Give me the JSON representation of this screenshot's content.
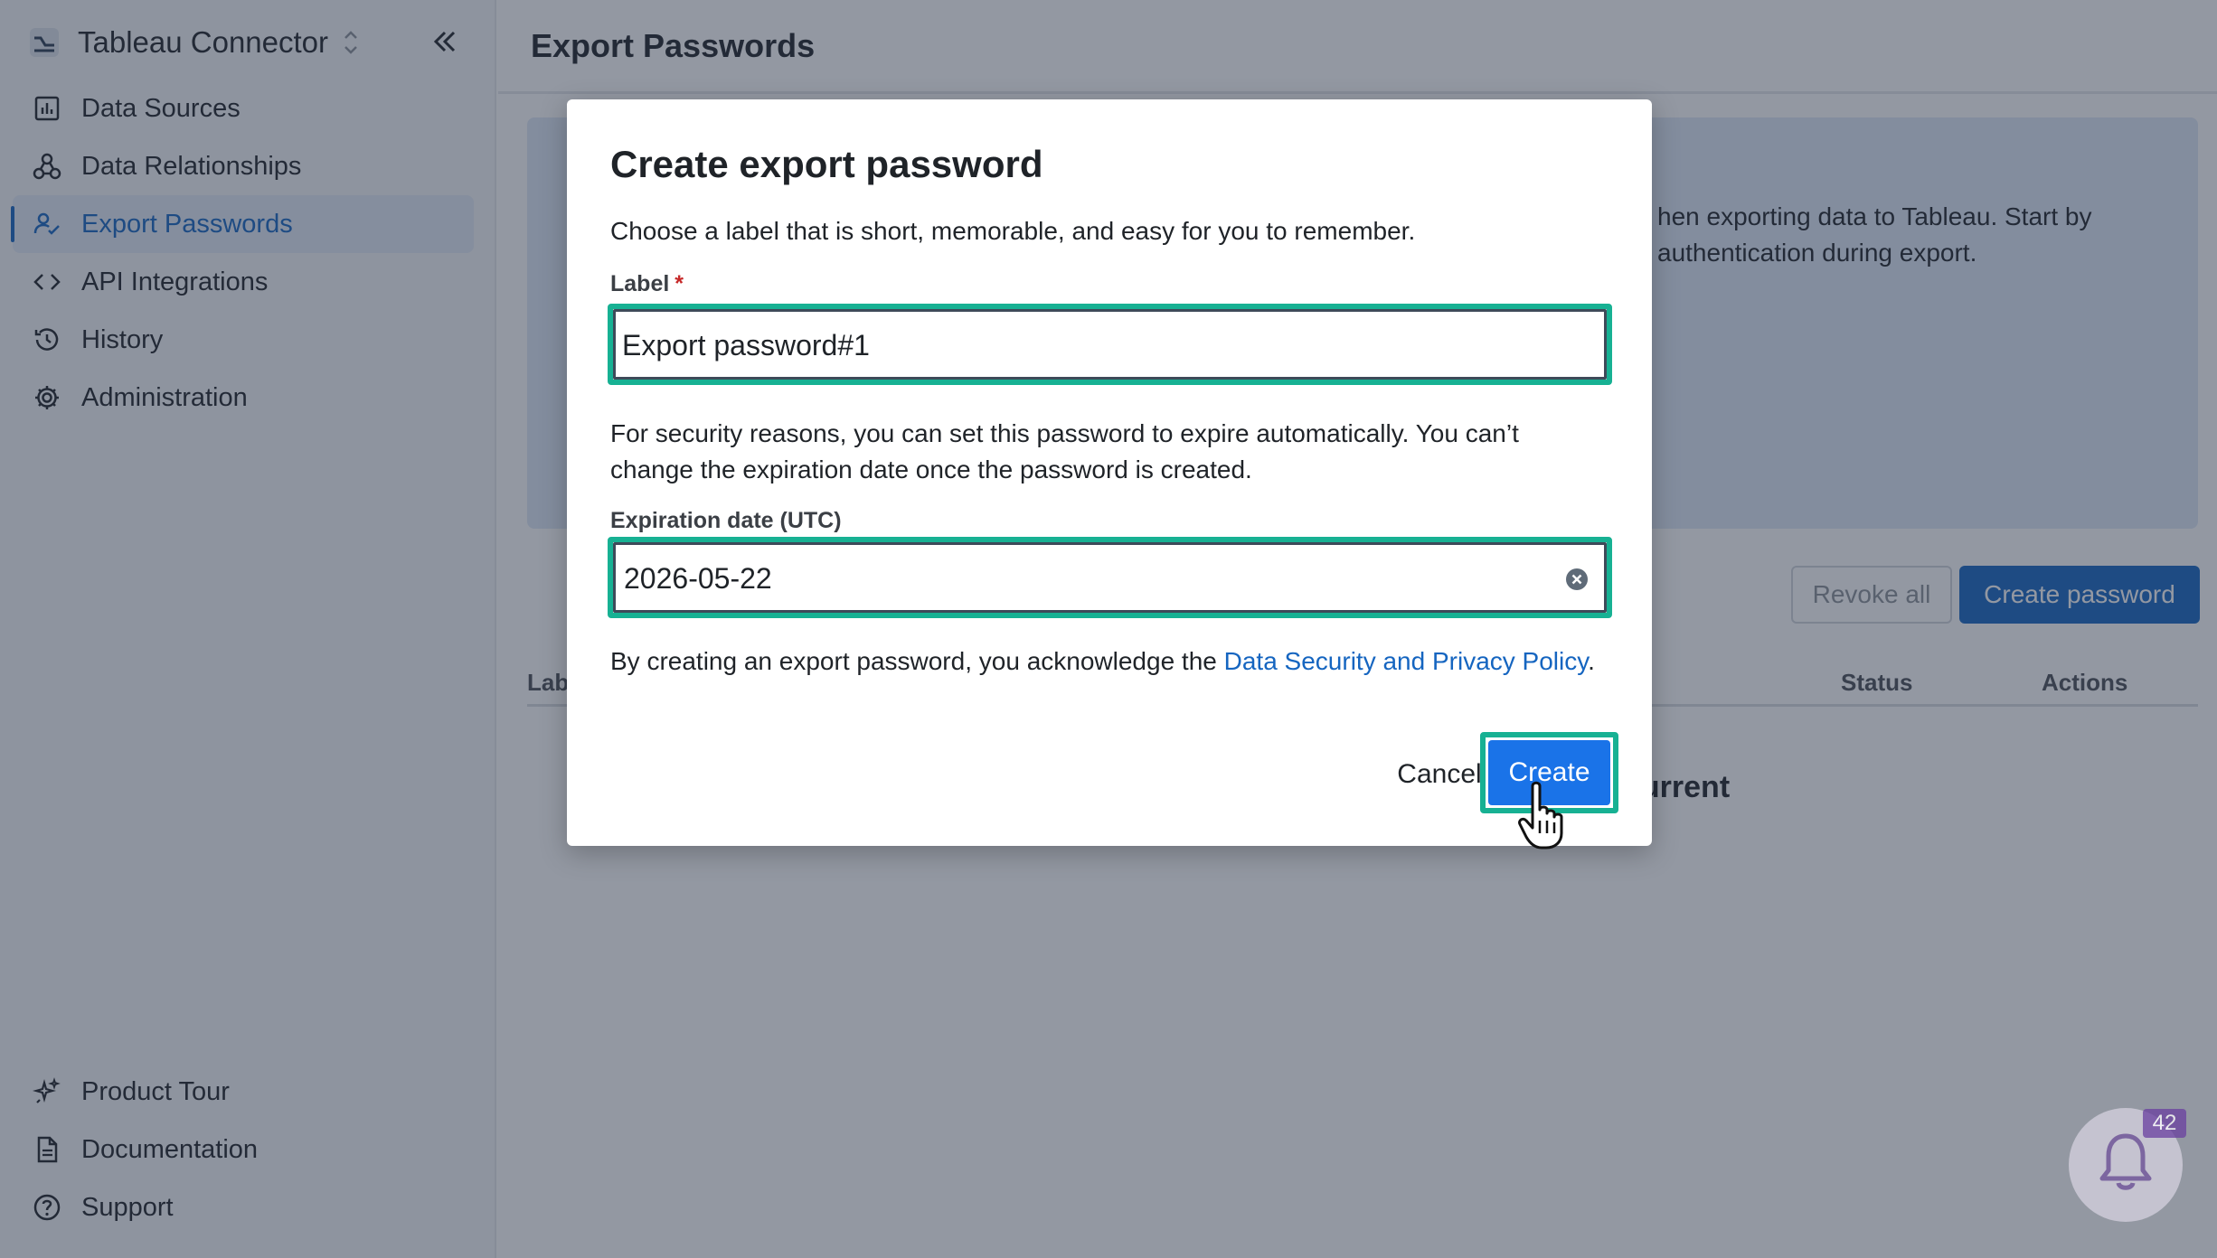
{
  "sidebar": {
    "app_name": "Tableau Connector",
    "nav": [
      {
        "label": "Data Sources",
        "icon": "chart-icon"
      },
      {
        "label": "Data Relationships",
        "icon": "relationship-icon"
      },
      {
        "label": "Export Passwords",
        "icon": "user-check-icon",
        "active": true
      },
      {
        "label": "API Integrations",
        "icon": "code-icon"
      },
      {
        "label": "History",
        "icon": "history-icon"
      },
      {
        "label": "Administration",
        "icon": "gear-icon"
      }
    ],
    "bottom_nav": [
      {
        "label": "Product Tour",
        "icon": "sparkle-icon"
      },
      {
        "label": "Documentation",
        "icon": "document-icon"
      },
      {
        "label": "Support",
        "icon": "help-icon"
      }
    ]
  },
  "main": {
    "title": "Export Passwords",
    "info_line1": "hen exporting data to Tableau. Start by",
    "info_line2": "authentication during export.",
    "revoke_all": "Revoke all",
    "create_password": "Create password",
    "columns": [
      "Lab",
      "Status",
      "Actions"
    ],
    "empty_fragment": "current"
  },
  "modal": {
    "title": "Create export password",
    "description": "Choose a label that is short, memorable, and easy for you to remember.",
    "label_field": {
      "label": "Label",
      "required_mark": "*",
      "value": "Export password#1"
    },
    "security_note": "For security reasons, you can set this password to expire automatically. You can’t change the expiration date once the password is created.",
    "expiration_field": {
      "label": "Expiration date (UTC)",
      "value": "2026-05-22"
    },
    "ack_prefix": "By creating an export password, you acknowledge the ",
    "ack_link": "Data Security and Privacy Policy",
    "ack_suffix": ".",
    "cancel": "Cancel",
    "create": "Create"
  },
  "notifications": {
    "count": "42"
  },
  "colors": {
    "accent": "#1565c0",
    "primary_button": "#1a73e8",
    "highlight": "#17b193",
    "badge": "#6a3fa0"
  }
}
